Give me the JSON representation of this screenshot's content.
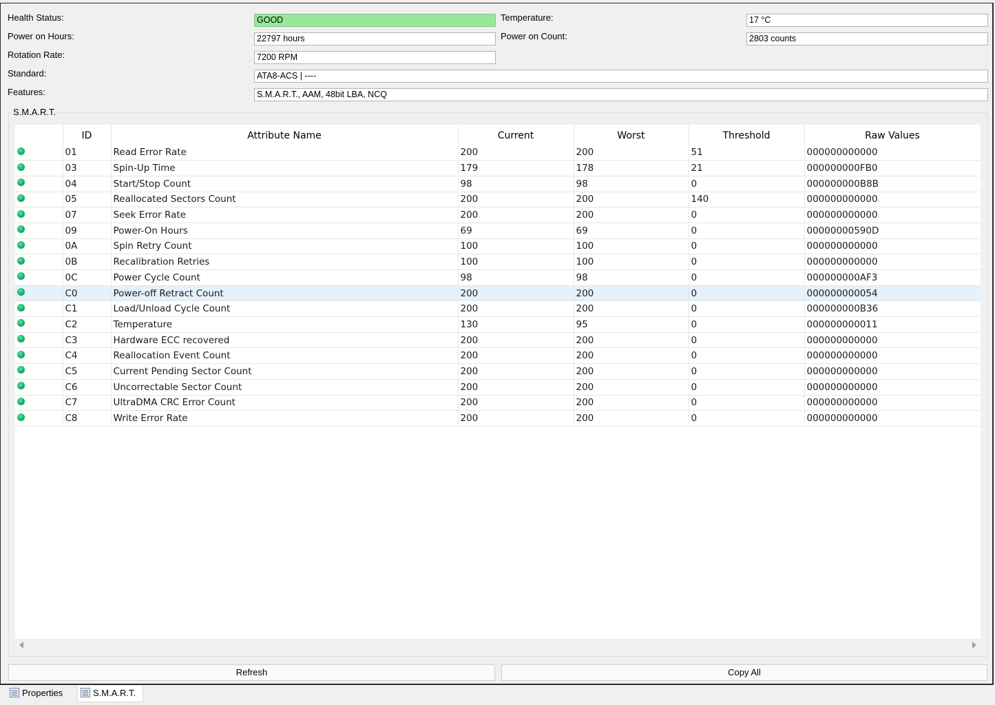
{
  "info": {
    "health_label": "Health Status:",
    "health_value": "GOOD",
    "temperature_label": "Temperature:",
    "temperature_value": "17 °C",
    "power_hours_label": "Power on Hours:",
    "power_hours_value": "22797 hours",
    "power_count_label": "Power on Count:",
    "power_count_value": "2803 counts",
    "rotation_label": "Rotation Rate:",
    "rotation_value": "7200 RPM",
    "standard_label": "Standard:",
    "standard_value": "ATA8-ACS | ----",
    "features_label": "Features:",
    "features_value": "S.M.A.R.T., AAM, 48bit LBA, NCQ"
  },
  "smart": {
    "group_title": "S.M.A.R.T.",
    "columns": [
      "",
      "ID",
      "Attribute Name",
      "Current",
      "Worst",
      "Threshold",
      "Raw Values"
    ],
    "rows": [
      {
        "id": "01",
        "name": "Read Error Rate",
        "current": "200",
        "worst": "200",
        "threshold": "51",
        "raw": "000000000000"
      },
      {
        "id": "03",
        "name": "Spin-Up Time",
        "current": "179",
        "worst": "178",
        "threshold": "21",
        "raw": "000000000FB0"
      },
      {
        "id": "04",
        "name": "Start/Stop Count",
        "current": "98",
        "worst": "98",
        "threshold": "0",
        "raw": "000000000B8B"
      },
      {
        "id": "05",
        "name": "Reallocated Sectors Count",
        "current": "200",
        "worst": "200",
        "threshold": "140",
        "raw": "000000000000"
      },
      {
        "id": "07",
        "name": "Seek Error Rate",
        "current": "200",
        "worst": "200",
        "threshold": "0",
        "raw": "000000000000"
      },
      {
        "id": "09",
        "name": "Power-On Hours",
        "current": "69",
        "worst": "69",
        "threshold": "0",
        "raw": "00000000590D"
      },
      {
        "id": "0A",
        "name": "Spin Retry Count",
        "current": "100",
        "worst": "100",
        "threshold": "0",
        "raw": "000000000000"
      },
      {
        "id": "0B",
        "name": "Recalibration Retries",
        "current": "100",
        "worst": "100",
        "threshold": "0",
        "raw": "000000000000"
      },
      {
        "id": "0C",
        "name": "Power Cycle Count",
        "current": "98",
        "worst": "98",
        "threshold": "0",
        "raw": "000000000AF3"
      },
      {
        "id": "C0",
        "name": "Power-off Retract Count",
        "current": "200",
        "worst": "200",
        "threshold": "0",
        "raw": "000000000054",
        "selected": true
      },
      {
        "id": "C1",
        "name": "Load/Unload Cycle Count",
        "current": "200",
        "worst": "200",
        "threshold": "0",
        "raw": "000000000B36"
      },
      {
        "id": "C2",
        "name": "Temperature",
        "current": "130",
        "worst": "95",
        "threshold": "0",
        "raw": "000000000011"
      },
      {
        "id": "C3",
        "name": "Hardware ECC recovered",
        "current": "200",
        "worst": "200",
        "threshold": "0",
        "raw": "000000000000"
      },
      {
        "id": "C4",
        "name": "Reallocation Event Count",
        "current": "200",
        "worst": "200",
        "threshold": "0",
        "raw": "000000000000"
      },
      {
        "id": "C5",
        "name": "Current Pending Sector Count",
        "current": "200",
        "worst": "200",
        "threshold": "0",
        "raw": "000000000000"
      },
      {
        "id": "C6",
        "name": "Uncorrectable Sector Count",
        "current": "200",
        "worst": "200",
        "threshold": "0",
        "raw": "000000000000"
      },
      {
        "id": "C7",
        "name": "UltraDMA CRC Error Count",
        "current": "200",
        "worst": "200",
        "threshold": "0",
        "raw": "000000000000"
      },
      {
        "id": "C8",
        "name": "Write Error Rate",
        "current": "200",
        "worst": "200",
        "threshold": "0",
        "raw": "000000000000"
      }
    ]
  },
  "buttons": {
    "refresh": "Refresh",
    "copy_all": "Copy All"
  },
  "tabs": [
    {
      "label": "Properties",
      "icon": "properties-icon",
      "active": false
    },
    {
      "label": "S.M.A.R.T.",
      "icon": "smart-icon",
      "active": true
    }
  ],
  "colors": {
    "good": "#98e898",
    "status_dot": "#16b06a",
    "selected_row": "#e5f1fb"
  }
}
